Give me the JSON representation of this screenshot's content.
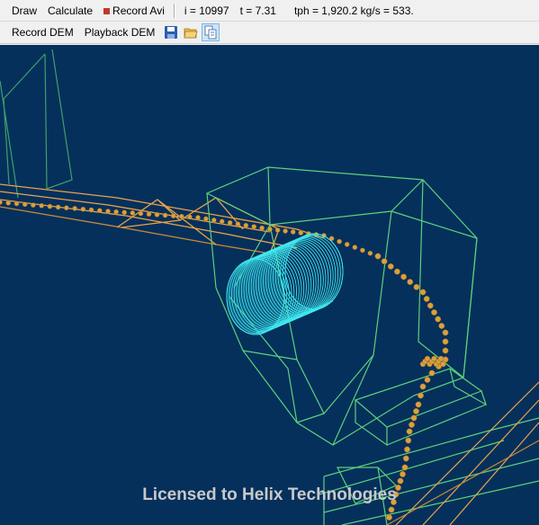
{
  "toolbar_top": {
    "draw_label": "Draw",
    "calculate_label": "Calculate",
    "record_avi_label": "Record Avi",
    "iteration": "i = 10997",
    "time": "t = 7.31",
    "throughput": "tph = 1,920.2 kg/s = 533."
  },
  "toolbar_bottom": {
    "record_dem_label": "Record DEM",
    "playback_dem_label": "Playback DEM",
    "icons": [
      "save-icon",
      "open-folder-icon",
      "copy-icon"
    ]
  },
  "viewport": {
    "background": "#05305c",
    "watermark": "Licensed to Helix Technologies",
    "colors": {
      "conveyor": "#e8a34a",
      "chute": "#5dd17a",
      "drum": "#40e8f0",
      "particles": "#d9a040"
    }
  }
}
